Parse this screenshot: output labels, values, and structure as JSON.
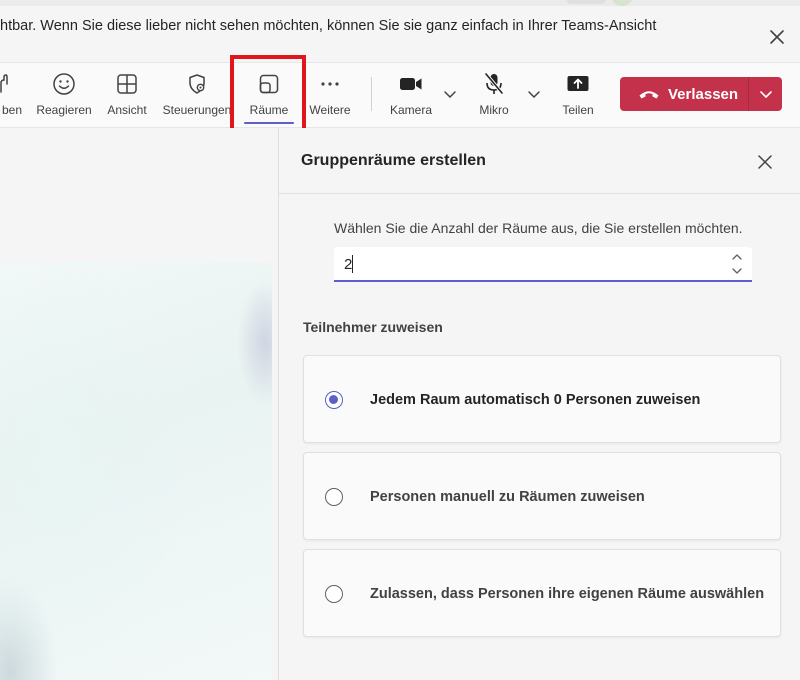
{
  "banner": {
    "text": "htbar. Wenn Sie diese lieber nicht sehen möchten, können Sie sie ganz einfach in Ihrer Teams-Ansicht"
  },
  "toolbar": {
    "buttons": [
      {
        "label": "ben",
        "icon": "raise-hand-icon"
      },
      {
        "label": "Reagieren",
        "icon": "smiley-icon"
      },
      {
        "label": "Ansicht",
        "icon": "grid-view-icon"
      },
      {
        "label": "Steuerungen",
        "icon": "shield-gear-icon"
      },
      {
        "label": "Räume",
        "icon": "breakout-rooms-icon"
      },
      {
        "label": "Weitere",
        "icon": "more-dots-icon"
      },
      {
        "label": "Kamera",
        "icon": "camera-icon"
      },
      {
        "label": "Mikro",
        "icon": "mic-off-icon"
      },
      {
        "label": "Teilen",
        "icon": "share-icon"
      }
    ],
    "leave": {
      "label": "Verlassen",
      "color": "#c4314b"
    },
    "active_tab": "Räume",
    "highlight_color": "#e0161e",
    "accent_color": "#5b5fc7"
  },
  "panel": {
    "title": "Gruppenräume erstellen",
    "count_label": "Wählen Sie die Anzahl der Räume aus, die Sie erstellen möchten.",
    "count_value": "2",
    "assign_heading": "Teilnehmer zuweisen",
    "options": [
      {
        "label": "Jedem Raum automatisch 0 Personen zuweisen",
        "selected": true
      },
      {
        "label": "Personen manuell zu Räumen zuweisen",
        "selected": false
      },
      {
        "label": "Zulassen, dass Personen ihre eigenen Räume auswählen",
        "selected": false
      }
    ]
  }
}
